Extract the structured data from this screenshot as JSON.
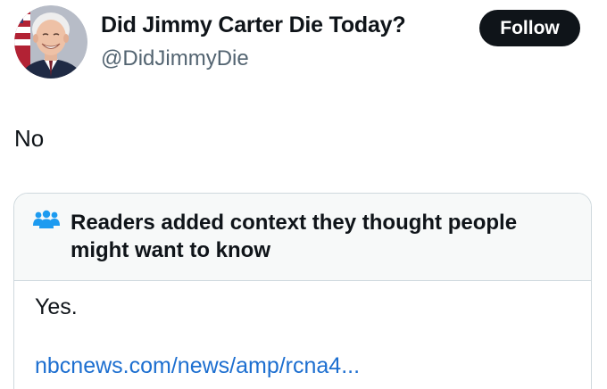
{
  "author": {
    "display_name": "Did Jimmy Carter Die Today?",
    "handle": "@DidJimmyDie",
    "avatar_icon": "portrait-avatar"
  },
  "follow_button": {
    "label": "Follow"
  },
  "tweet": {
    "text": "No"
  },
  "community_note": {
    "icon": "people-icon",
    "title": "Readers added context they thought people might want to know",
    "body": "Yes.",
    "link_text": "nbcnews.com/news/amp/rcna4..."
  },
  "colors": {
    "text": "#0f1419",
    "secondary_text": "#536471",
    "follow_bg": "#0f1419",
    "note_header_bg": "#f7f9f9",
    "note_border": "#cfd9de",
    "note_icon": "#1d9bf0",
    "link": "#1d6fd0"
  }
}
